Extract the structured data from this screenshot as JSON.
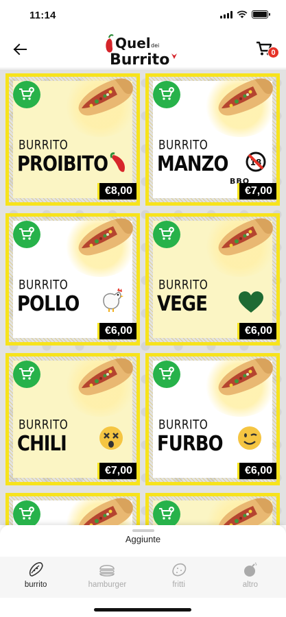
{
  "status_bar": {
    "time": "11:14"
  },
  "header": {
    "logo_line1": "Quel",
    "logo_small": "dei",
    "logo_line2": "Burrito",
    "cart_count": "0"
  },
  "products": [
    {
      "category": "BURRITO",
      "name": "PROIBITO",
      "sub": "",
      "price": "€8,00",
      "bg": "yellow",
      "deco": "chili-pepper-icon"
    },
    {
      "category": "BURRITO",
      "name": "MANZO",
      "sub": "BBQ",
      "price": "€7,00",
      "bg": "white",
      "deco": "no-18-icon"
    },
    {
      "category": "BURRITO",
      "name": "POLLO",
      "sub": "",
      "price": "€6,00",
      "bg": "white",
      "deco": "chicken-icon"
    },
    {
      "category": "BURRITO",
      "name": "VEGE",
      "sub": "",
      "price": "€6,00",
      "bg": "yellow",
      "deco": "green-heart-icon"
    },
    {
      "category": "BURRITO",
      "name": "CHILI",
      "sub": "",
      "price": "€7,00",
      "bg": "yellow",
      "deco": "dizzy-face-icon"
    },
    {
      "category": "BURRITO",
      "name": "FURBO",
      "sub": "",
      "price": "€6,00",
      "bg": "white",
      "deco": "winking-face-icon"
    }
  ],
  "sheet": {
    "title": "Aggiunte"
  },
  "tabs": [
    {
      "label": "burrito",
      "icon": "burrito-icon",
      "active": true
    },
    {
      "label": "hamburger",
      "icon": "hamburger-icon",
      "active": false
    },
    {
      "label": "fritti",
      "icon": "potato-icon",
      "active": false
    },
    {
      "label": "altro",
      "icon": "bomb-icon",
      "active": false
    }
  ],
  "colors": {
    "card_border": "#f7e31c",
    "add_button": "#27b24a",
    "badge": "#e63227",
    "price_bg": "#000000"
  }
}
